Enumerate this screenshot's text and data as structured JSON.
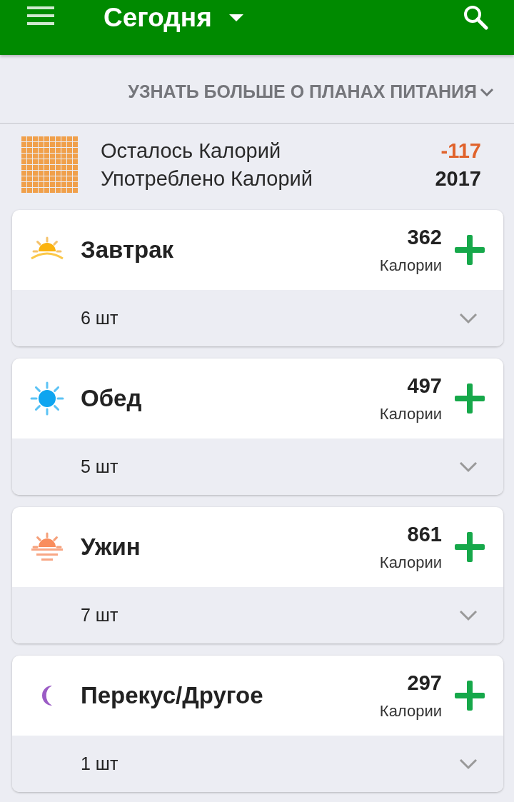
{
  "header": {
    "title": "Сегодня"
  },
  "plans_link": "УЗНАТЬ БОЛЬШЕ О ПЛАНАХ ПИТАНИЯ",
  "summary": [
    {
      "label": "Осталось Калорий",
      "value": "-117",
      "kind": "negative"
    },
    {
      "label": "Употреблено Калорий",
      "value": "2017",
      "kind": "normal"
    }
  ],
  "meals": [
    {
      "kind": "breakfast",
      "name": "Завтрак",
      "calories": "362",
      "unit": "Калории",
      "count": "6 шт"
    },
    {
      "kind": "lunch",
      "name": "Обед",
      "calories": "497",
      "unit": "Калории",
      "count": "5 шт"
    },
    {
      "kind": "dinner",
      "name": "Ужин",
      "calories": "861",
      "unit": "Калории",
      "count": "7 шт"
    },
    {
      "kind": "snack",
      "name": "Перекус/Другое",
      "calories": "297",
      "unit": "Калории",
      "count": "1 шт"
    }
  ]
}
